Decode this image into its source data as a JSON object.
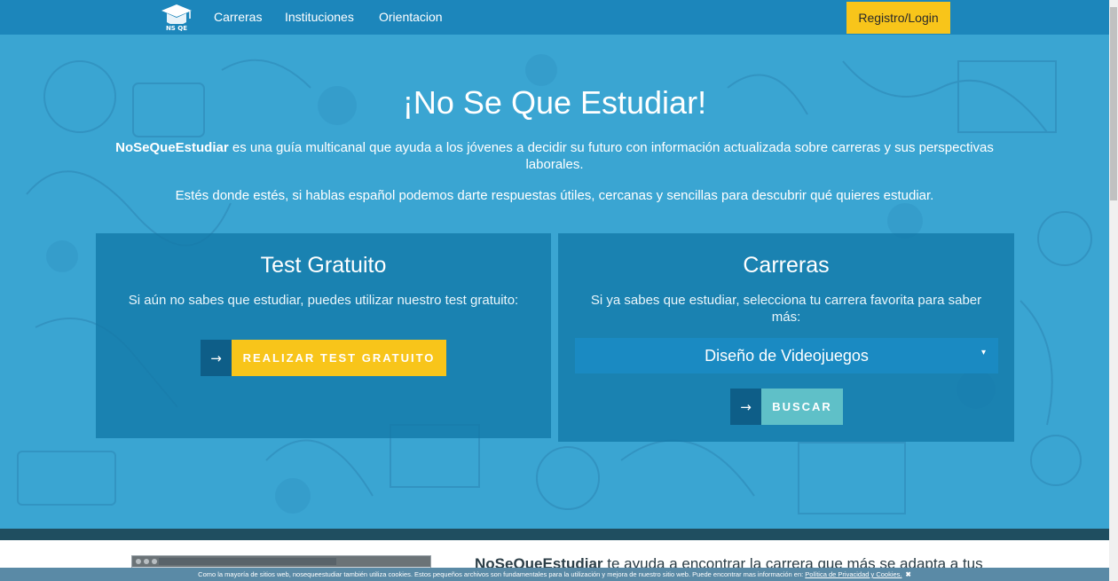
{
  "nav": {
    "logo_text": "NS QE",
    "links": [
      "Carreras",
      "Instituciones",
      "Orientacion"
    ],
    "login": "Registro/Login"
  },
  "hero": {
    "title": "¡No Se Que Estudiar!",
    "brand": "NoSeQueEstudiar",
    "desc": " es una guía multicanal que ayuda a los jóvenes a decidir su futuro con información actualizada sobre carreras y sus perspectivas laborales.",
    "desc2": "Estés donde estés, si hablas español podemos darte respuestas útiles, cercanas y sencillas para descubrir qué quieres estudiar."
  },
  "test_card": {
    "title": "Test Gratuito",
    "text": "Si aún no sabes que estudiar, puedes utilizar nuestro test gratuito:",
    "button": "REALIZAR TEST GRATUITO"
  },
  "career_card": {
    "title": "Carreras",
    "text": "Si ya sabes que estudiar, selecciona tu carrera favorita para saber más:",
    "selected": "Diseño de Videojuegos",
    "button": "BUSCAR"
  },
  "lower": {
    "brand": "NoSeQueEstudiar",
    "text": " te ayuda a encontrar la carrera que más se adapta a tus"
  },
  "cookie": {
    "text": "Como la mayoría de sitios web, nosequeestudiar también utiliza cookies. Estos pequeños archivos son fundamentales para la utilización y mejora de nuestro sitio web. Puede encontrar mas información en: ",
    "link": "Política de Privacidad y Cookies.",
    "close": "✖"
  },
  "icons": {
    "arrow": "→",
    "caret": "▾"
  },
  "colors": {
    "nav": "#1c86bb",
    "hero": "#3aa5d2",
    "accent": "#f8c51a",
    "buscar": "#5fc0c8"
  }
}
